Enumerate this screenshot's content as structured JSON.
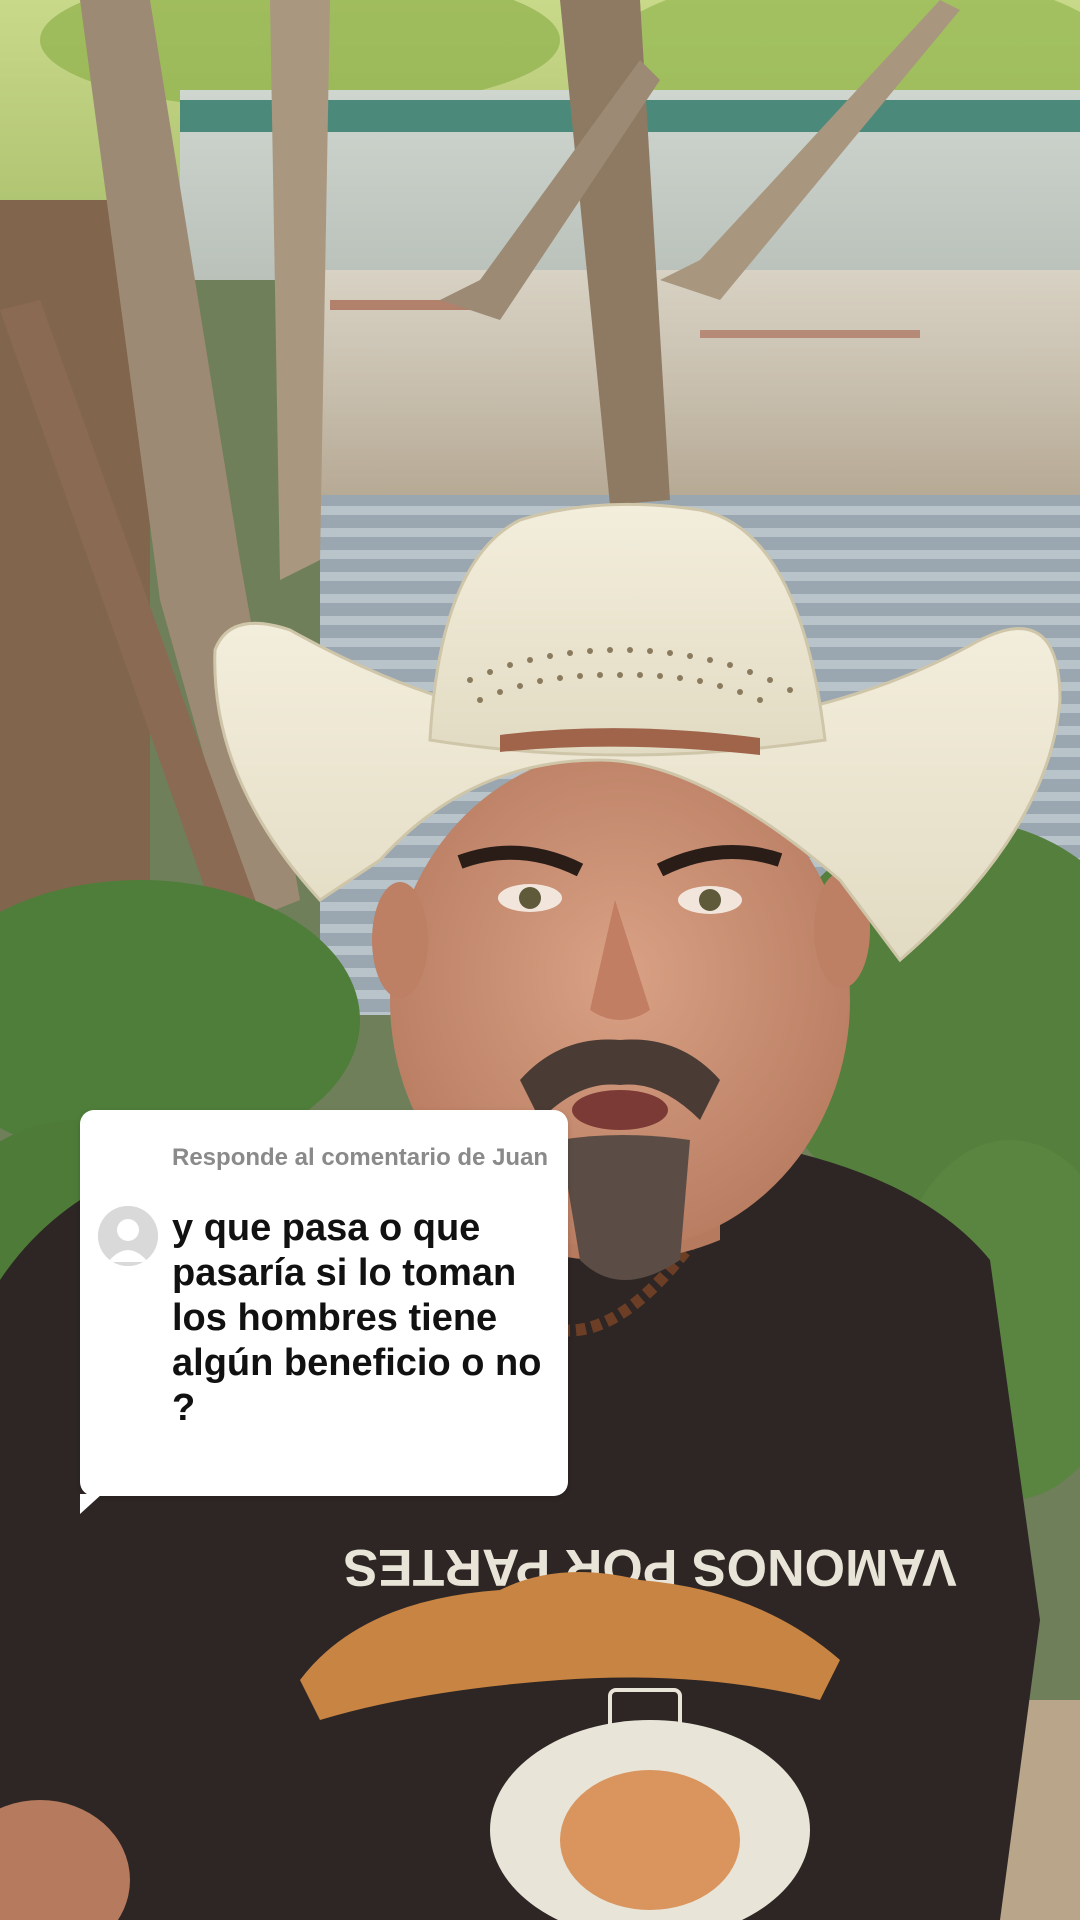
{
  "reply_sticker": {
    "header": "Responde al comentario de Juan",
    "comment": "y que pasa o que pasaría si lo toman los hombres tiene algún beneficio o no ?",
    "avatar_icon": "default-user-avatar-icon"
  },
  "shirt_graphic": {
    "text": "VAMONOS POR PARTES"
  },
  "colors": {
    "sticker_background": "#ffffff",
    "header_text": "#8a8a8a",
    "comment_text": "#111111"
  }
}
